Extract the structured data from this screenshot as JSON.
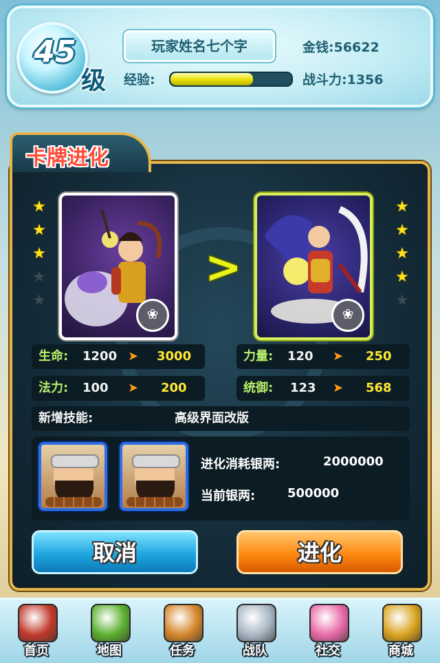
{
  "header": {
    "level": "45",
    "level_unit": "级",
    "player_name": "玩家姓名七个字",
    "gold_label": "金钱:56622",
    "exp_label": "经验:",
    "exp_progress": 0.68,
    "power_label": "战斗力:1356"
  },
  "panel": {
    "title": "卡牌进化",
    "left_card": {
      "stars": 3,
      "max_stars": 5,
      "icon": "lotus-icon"
    },
    "right_card": {
      "stars": 4,
      "max_stars": 5,
      "icon": "lotus-icon"
    },
    "stats": {
      "hp": {
        "label": "生命:",
        "from": "1200",
        "to": "3000"
      },
      "strength": {
        "label": "力量:",
        "from": "120",
        "to": "250"
      },
      "mana": {
        "label": "法力:",
        "from": "100",
        "to": "200"
      },
      "command": {
        "label": "统御:",
        "from": "123",
        "to": "568"
      },
      "skill": {
        "label": "新增技能:",
        "value": "高级界面改版"
      }
    },
    "cost": {
      "consume_label": "进化消耗银两:",
      "consume_value": "2000000",
      "current_label": "当前银两:",
      "current_value": "500000"
    },
    "buttons": {
      "cancel": "取消",
      "evolve": "进化"
    }
  },
  "nav": [
    {
      "label": "首页",
      "icon": "home-icon",
      "color": "#c0392b"
    },
    {
      "label": "地图",
      "icon": "map-icon",
      "color": "#5bb030"
    },
    {
      "label": "任务",
      "icon": "quest-icon",
      "color": "#d4862a"
    },
    {
      "label": "战队",
      "icon": "swords-icon",
      "color": "#a7b6c2"
    },
    {
      "label": "社交",
      "icon": "handshake-icon",
      "color": "#e86aa8"
    },
    {
      "label": "商城",
      "icon": "shop-icon",
      "color": "#d9a320"
    }
  ]
}
